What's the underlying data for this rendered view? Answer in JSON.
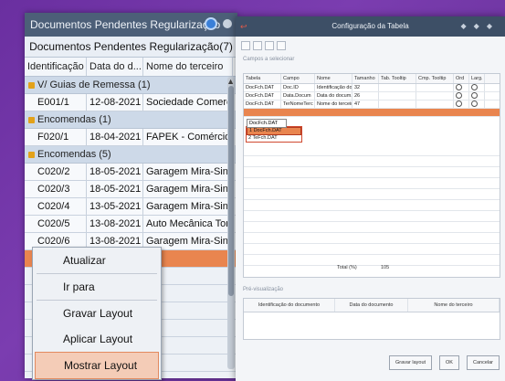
{
  "left_panel": {
    "title": "Documentos Pendentes Regularização",
    "subtitle": "Documentos Pendentes Regularização(7)",
    "columns": [
      "Identificação ...",
      "Data do d...",
      "Nome do terceiro"
    ],
    "groups": [
      {
        "label": "V/ Guias de Remessa (1)",
        "rows": [
          [
            "E001/1",
            "12-08-2021",
            "Sociedade Comerci..."
          ]
        ]
      },
      {
        "label": "Encomendas (1)",
        "rows": [
          [
            "F020/1",
            "18-04-2021",
            "FAPEK - Comércio d..."
          ]
        ]
      },
      {
        "label": "Encomendas (5)",
        "rows": [
          [
            "C020/2",
            "18-05-2021",
            "Garagem Mira-Sintra..."
          ],
          [
            "C020/3",
            "18-05-2021",
            "Garagem Mira-Sintra..."
          ],
          [
            "C020/4",
            "13-05-2021",
            "Garagem Mira-Sintra..."
          ],
          [
            "C020/5",
            "13-08-2021",
            "Auto Mecânica Torre..."
          ],
          [
            "C020/6",
            "13-08-2021",
            "Garagem Mira-Sintra..."
          ]
        ]
      }
    ]
  },
  "context_menu": {
    "items": [
      "Atualizar",
      "Ir para",
      "Gravar Layout",
      "Aplicar Layout",
      "Mostrar Layout"
    ],
    "highlighted": "Mostrar Layout"
  },
  "config_window": {
    "title": "Configuração da Tabela",
    "fields_label": "Campos a selecionar",
    "columns": [
      "Tabela",
      "Campo",
      "Nome",
      "Tamanho",
      "Tab. Tooltip",
      "Cmp. Tooltip",
      "Ord",
      "Larg."
    ],
    "rows": [
      [
        "DocFch.DAT",
        "Doc.ID",
        "Identificação do...",
        "32",
        "",
        ""
      ],
      [
        "DocFch.DAT",
        "Data.Docum",
        "Data do docum...",
        "26",
        "",
        ""
      ],
      [
        "DocFch.DAT",
        "TerNomeTerc",
        "Nome do terceiro",
        "47",
        "",
        ""
      ]
    ],
    "combo_value": "DocFch.DAT",
    "combo_options": [
      "DocFch.DAT",
      "1 DocFch.DAT",
      "2 TeFch.DAT"
    ],
    "total_label": "Total (%)",
    "total_value": "105",
    "preview_label": "Pré-visualização",
    "preview_columns": [
      "Identificação do documento",
      "Data do documento",
      "Nome do terceiro"
    ],
    "buttons": [
      "Gravar layout",
      "OK",
      "Cancelar"
    ]
  },
  "colors": {
    "accent": "#e9854f",
    "window_title": "#4c5f78"
  }
}
